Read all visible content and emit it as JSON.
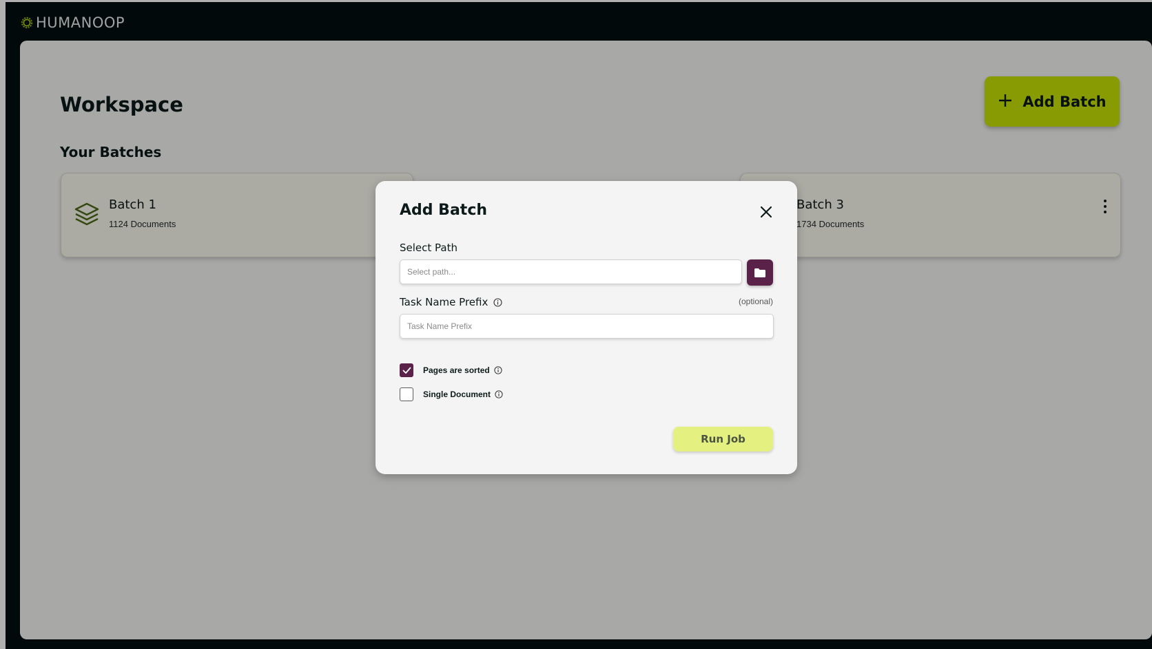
{
  "brand": {
    "name": "HUMANOOP"
  },
  "page": {
    "title": "Workspace",
    "section_title": "Your Batches"
  },
  "toolbar": {
    "add_batch_label": "Add Batch"
  },
  "batches": [
    {
      "name": "Batch 1",
      "documents": "1124 Documents"
    },
    {
      "name": "Batch 3",
      "documents": "1734 Documents"
    }
  ],
  "modal": {
    "title": "Add Batch",
    "select_path_label": "Select Path",
    "select_path_placeholder": "Select path...",
    "task_prefix_label": "Task Name Prefix",
    "task_prefix_optional": "(optional)",
    "task_prefix_placeholder": "Task Name Prefix",
    "options": [
      {
        "label": "Pages are sorted",
        "checked": true
      },
      {
        "label": "Single Document",
        "checked": false
      }
    ],
    "run_label": "Run Job"
  },
  "colors": {
    "header_bg": "#030e10",
    "accent_lime": "#c6e105",
    "accent_plum": "#5a2249",
    "run_button": "#e4f080"
  }
}
